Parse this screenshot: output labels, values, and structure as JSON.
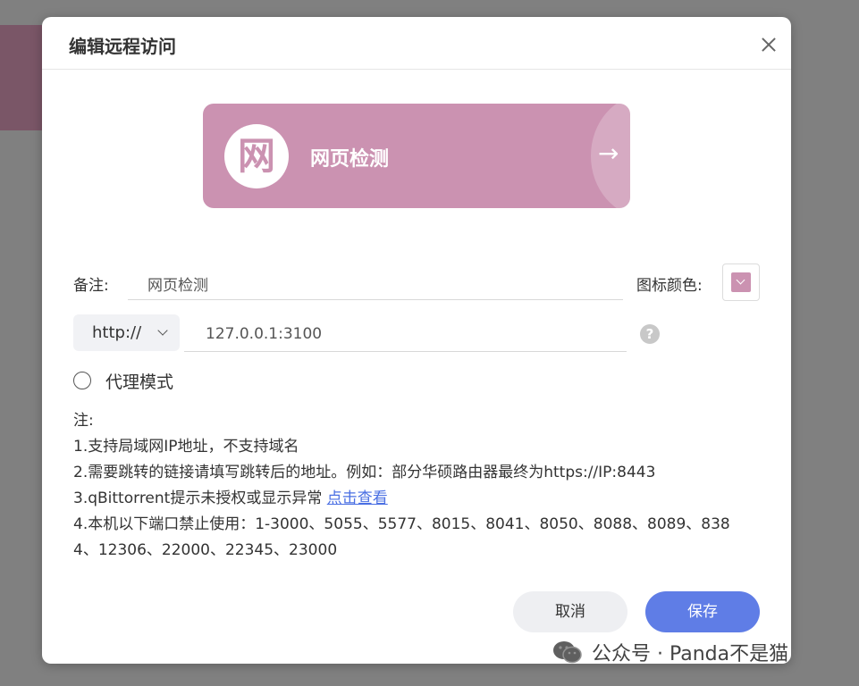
{
  "dialog": {
    "title": "编辑远程访问"
  },
  "preview": {
    "icon_char": "网",
    "title": "网页检测",
    "arrow": "→",
    "color": "#cb92b1"
  },
  "form": {
    "note_label": "备注:",
    "note_value": "网页检测",
    "icon_color_label": "图标颜色:",
    "protocol_value": "http://",
    "address_value": "127.0.0.1:3100",
    "help_char": "?",
    "proxy_label": "代理模式"
  },
  "notes": {
    "heading": "注:",
    "line1": "1.支持局域网IP地址，不支持域名",
    "line2": "2.需要跳转的链接请填写跳转后的地址。例如：部分华硕路由器最终为https://IP:8443",
    "line3_text": "3.qBittorrent提示未授权或显示异常 ",
    "line3_link": "点击查看",
    "line4": "4.本机以下端口禁止使用：1-3000、5055、5577、8015、8041、8050、8088、8089、8384、12306、22000、22345、23000"
  },
  "buttons": {
    "cancel": "取消",
    "save": "保存"
  },
  "watermark": {
    "text": "公众号 · Panda不是猫"
  }
}
